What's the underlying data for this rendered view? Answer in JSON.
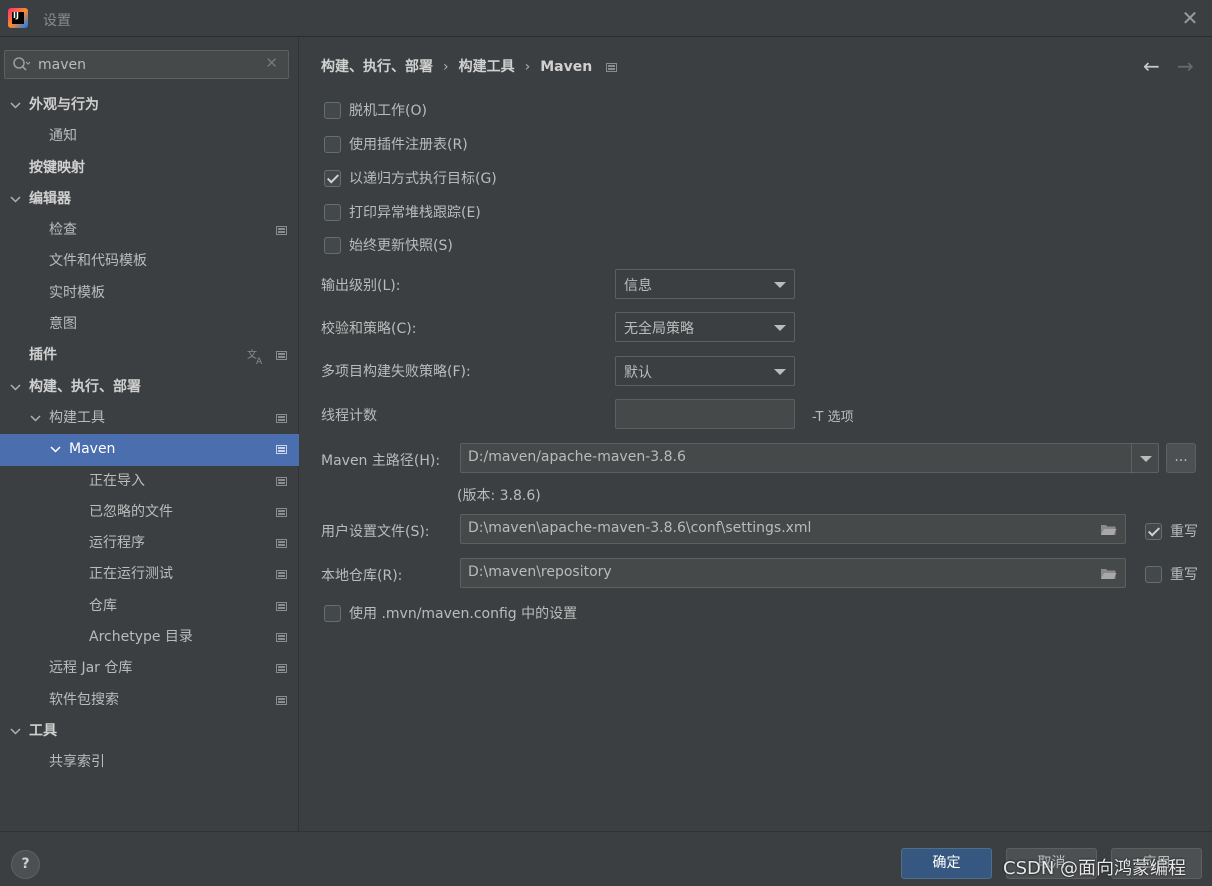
{
  "window": {
    "title": "设置"
  },
  "search": {
    "value": "maven"
  },
  "sidebar": {
    "items": [
      {
        "label": "外观与行为",
        "expanded": true,
        "bold": true,
        "level": 0,
        "project": false
      },
      {
        "label": "通知",
        "level": 1,
        "project": false
      },
      {
        "label": "按键映射",
        "bold": true,
        "level": 0,
        "project": false,
        "noChevron": true
      },
      {
        "label": "编辑器",
        "expanded": true,
        "bold": true,
        "level": 0,
        "project": false
      },
      {
        "label": "检查",
        "level": 1,
        "project": true
      },
      {
        "label": "文件和代码模板",
        "level": 1,
        "project": false
      },
      {
        "label": "实时模板",
        "level": 1,
        "project": false
      },
      {
        "label": "意图",
        "level": 1,
        "project": false
      },
      {
        "label": "插件",
        "bold": true,
        "level": 0,
        "project": true,
        "noChevron": true,
        "translate": true
      },
      {
        "label": "构建、执行、部署",
        "expanded": true,
        "bold": true,
        "level": 0,
        "project": false
      },
      {
        "label": "构建工具",
        "expanded": true,
        "level": 1,
        "project": true
      },
      {
        "label": "Maven",
        "expanded": true,
        "level": 2,
        "project": true,
        "selected": true
      },
      {
        "label": "正在导入",
        "level": 3,
        "project": true
      },
      {
        "label": "已忽略的文件",
        "level": 3,
        "project": true
      },
      {
        "label": "运行程序",
        "level": 3,
        "project": true
      },
      {
        "label": "正在运行测试",
        "level": 3,
        "project": true
      },
      {
        "label": "仓库",
        "level": 3,
        "project": true
      },
      {
        "label": "Archetype 目录",
        "level": 3,
        "project": true
      },
      {
        "label": "远程 Jar 仓库",
        "level": 1,
        "project": true
      },
      {
        "label": "软件包搜索",
        "level": 1,
        "project": true
      },
      {
        "label": "工具",
        "expanded": true,
        "bold": true,
        "level": 0,
        "project": false
      },
      {
        "label": "共享索引",
        "level": 1,
        "project": false
      }
    ]
  },
  "breadcrumb": {
    "part1": "构建、执行、部署",
    "part2": "构建工具",
    "part3": "Maven"
  },
  "options": {
    "offline": {
      "label": "脱机工作(O)",
      "checked": false
    },
    "plugin_registry": {
      "label": "使用插件注册表(R)",
      "checked": false
    },
    "recursive": {
      "label": "以递归方式执行目标(G)",
      "checked": true
    },
    "print_stack": {
      "label": "打印异常堆栈跟踪(E)",
      "checked": false
    },
    "update_snapshots": {
      "label": "始终更新快照(S)",
      "checked": false
    }
  },
  "output_level": {
    "label": "输出级别(L):",
    "value": "信息"
  },
  "checksum": {
    "label": "校验和策略(C):",
    "value": "无全局策略"
  },
  "fail_policy": {
    "label": "多项目构建失败策略(F):",
    "value": "默认"
  },
  "threads": {
    "label": "线程计数",
    "value": "",
    "suffix": "-T 选项"
  },
  "maven_home": {
    "label": "Maven 主路径(H):",
    "value": "D:/maven/apache-maven-3.8.6",
    "version": "(版本: 3.8.6)",
    "browse": "..."
  },
  "user_settings": {
    "label": "用户设置文件(S):",
    "value": "D:\\maven\\apache-maven-3.8.6\\conf\\settings.xml",
    "override_label": "重写",
    "override_checked": true
  },
  "local_repo": {
    "label": "本地仓库(R):",
    "value": "D:\\maven\\repository",
    "override_label": "重写",
    "override_checked": false
  },
  "mvn_config": {
    "label": "使用 .mvn/maven.config 中的设置",
    "checked": false
  },
  "footer": {
    "help": "?",
    "ok": "确定",
    "cancel": "取消",
    "apply": "应用",
    "watermark": "CSDN @面向鸿蒙编程"
  },
  "colors": {
    "selection": "#4b6eaf",
    "background": "#3c3f41",
    "ok_button": "#365880"
  }
}
